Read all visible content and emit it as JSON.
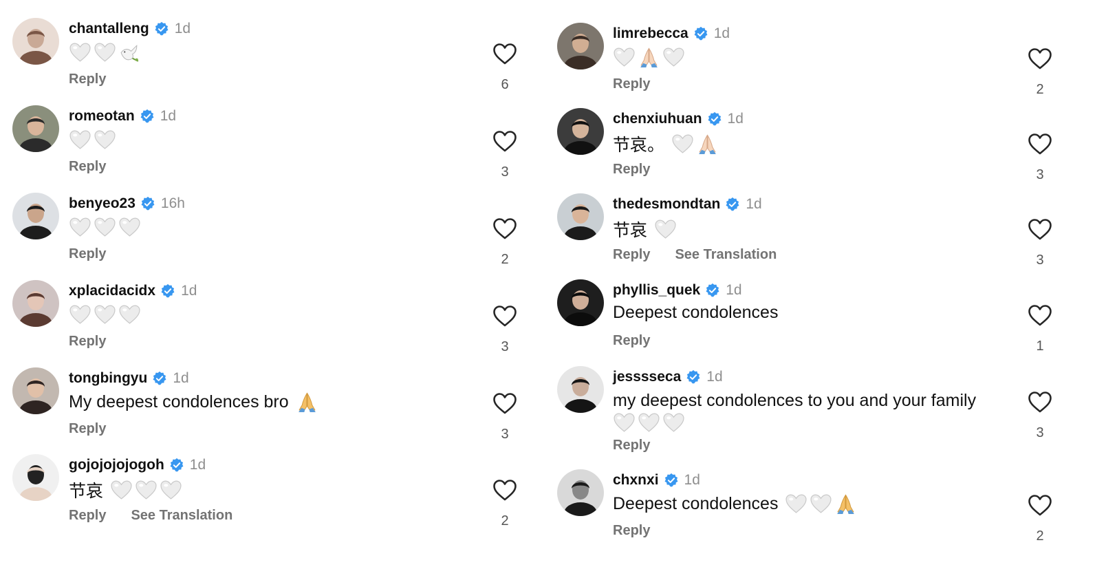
{
  "colors": {
    "verified": "#3897f0",
    "muted": "#737373",
    "heart_emoji": "#e9e9e9",
    "pray_emoji": "#f2c27b"
  },
  "left_comments": [
    {
      "username": "chantalleng",
      "time": "1d",
      "text": "",
      "emojis": [
        "white-heart",
        "white-heart",
        "dove"
      ],
      "reply": "Reply",
      "translation": "",
      "likes": "6"
    },
    {
      "username": "romeotan",
      "time": "1d",
      "text": "",
      "emojis": [
        "white-heart",
        "white-heart"
      ],
      "reply": "Reply",
      "translation": "",
      "likes": "3"
    },
    {
      "username": "benyeo23",
      "time": "16h",
      "text": "",
      "emojis": [
        "white-heart",
        "white-heart",
        "white-heart"
      ],
      "reply": "Reply",
      "translation": "",
      "likes": "2"
    },
    {
      "username": "xplacidacidx",
      "time": "1d",
      "text": "",
      "emojis": [
        "white-heart",
        "white-heart",
        "white-heart"
      ],
      "reply": "Reply",
      "translation": "",
      "likes": "3"
    },
    {
      "username": "tongbingyu",
      "time": "1d",
      "text": "My deepest condolences bro",
      "emojis": [
        "folded-hands"
      ],
      "reply": "Reply",
      "translation": "",
      "likes": "3"
    },
    {
      "username": "gojojojojogoh",
      "time": "1d",
      "text": "节哀",
      "emojis": [
        "white-heart",
        "white-heart",
        "white-heart"
      ],
      "reply": "Reply",
      "translation": "See Translation",
      "likes": "2"
    }
  ],
  "right_comments": [
    {
      "username": "limrebecca",
      "time": "1d",
      "text": "",
      "emojis": [
        "white-heart",
        "folded-hands-light",
        "white-heart"
      ],
      "reply": "Reply",
      "translation": "",
      "likes": "2"
    },
    {
      "username": "chenxiuhuan",
      "time": "1d",
      "text": "节哀。",
      "emojis": [
        "white-heart",
        "folded-hands-light"
      ],
      "reply": "Reply",
      "translation": "",
      "likes": "3"
    },
    {
      "username": "thedesmondtan",
      "time": "1d",
      "text": "节哀",
      "emojis": [
        "white-heart"
      ],
      "reply": "Reply",
      "translation": "See Translation",
      "likes": "3"
    },
    {
      "username": "phyllis_quek",
      "time": "1d",
      "text": "Deepest condolences",
      "emojis": [],
      "reply": "Reply",
      "translation": "",
      "likes": "1"
    },
    {
      "username": "jesssseca",
      "time": "1d",
      "text": "my deepest condolences to you and your family",
      "emojis": [
        "white-heart",
        "white-heart",
        "white-heart"
      ],
      "reply": "Reply",
      "translation": "",
      "likes": "3"
    },
    {
      "username": "chxnxi",
      "time": "1d",
      "text": "Deepest condolences",
      "emojis": [
        "white-heart",
        "white-heart",
        "folded-hands"
      ],
      "reply": "Reply",
      "translation": "",
      "likes": "2"
    }
  ]
}
